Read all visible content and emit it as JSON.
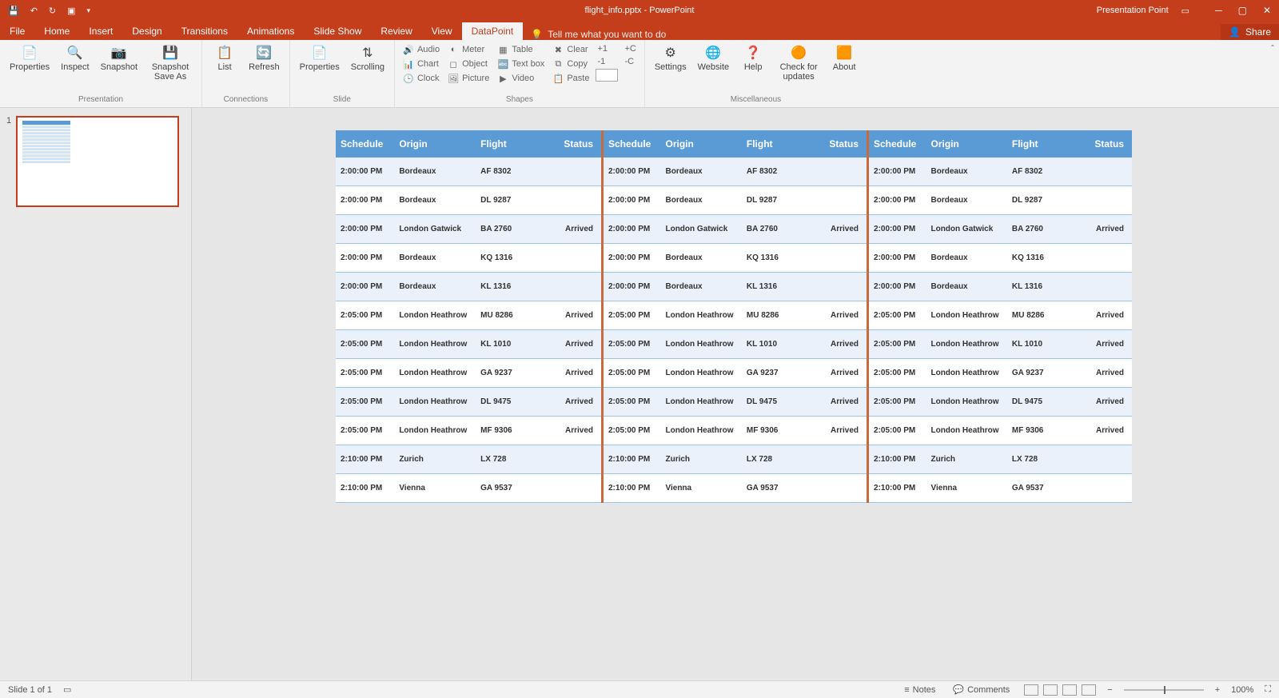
{
  "titlebar": {
    "doc_title": "flight_info.pptx - PowerPoint",
    "account": "Presentation Point"
  },
  "menu": {
    "tabs": [
      "File",
      "Home",
      "Insert",
      "Design",
      "Transitions",
      "Animations",
      "Slide Show",
      "Review",
      "View",
      "DataPoint"
    ],
    "active": "DataPoint",
    "tell_me": "Tell me what you want to do",
    "share": "Share"
  },
  "ribbon": {
    "groups": {
      "presentation": {
        "label": "Presentation",
        "buttons": [
          "Properties",
          "Inspect",
          "Snapshot",
          "Snapshot Save As"
        ]
      },
      "connections": {
        "label": "Connections",
        "buttons": [
          "List",
          "Refresh"
        ]
      },
      "slide": {
        "label": "Slide",
        "buttons": [
          "Properties",
          "Scrolling"
        ]
      },
      "shapes": {
        "label": "Shapes",
        "col1": [
          "Audio",
          "Chart",
          "Clock"
        ],
        "col2": [
          "Meter",
          "Object",
          "Picture"
        ],
        "col3": [
          "Table",
          "Text box",
          "Video"
        ],
        "col4": [
          "Clear",
          "Copy",
          "Paste"
        ],
        "col5": [
          "+1",
          "-1"
        ],
        "col6": [
          "+C",
          "-C"
        ]
      },
      "misc": {
        "label": "Miscellaneous",
        "buttons": [
          "Settings",
          "Website",
          "Help",
          "Check for updates",
          "About"
        ]
      }
    }
  },
  "thumb": {
    "number": "1"
  },
  "table": {
    "headers": [
      "Schedule",
      "Origin",
      "Flight",
      "Status"
    ],
    "rows": [
      {
        "schedule": "2:00:00 PM",
        "origin": "Bordeaux",
        "flight": "AF 8302",
        "status": ""
      },
      {
        "schedule": "2:00:00 PM",
        "origin": "Bordeaux",
        "flight": "DL 9287",
        "status": ""
      },
      {
        "schedule": "2:00:00 PM",
        "origin": "London Gatwick",
        "flight": "BA 2760",
        "status": "Arrived"
      },
      {
        "schedule": "2:00:00 PM",
        "origin": "Bordeaux",
        "flight": "KQ 1316",
        "status": ""
      },
      {
        "schedule": "2:00:00 PM",
        "origin": "Bordeaux",
        "flight": "KL 1316",
        "status": ""
      },
      {
        "schedule": "2:05:00 PM",
        "origin": "London Heathrow",
        "flight": "MU 8286",
        "status": "Arrived"
      },
      {
        "schedule": "2:05:00 PM",
        "origin": "London Heathrow",
        "flight": "KL 1010",
        "status": "Arrived"
      },
      {
        "schedule": "2:05:00 PM",
        "origin": "London Heathrow",
        "flight": "GA 9237",
        "status": "Arrived"
      },
      {
        "schedule": "2:05:00 PM",
        "origin": "London Heathrow",
        "flight": "DL 9475",
        "status": "Arrived"
      },
      {
        "schedule": "2:05:00 PM",
        "origin": "London Heathrow",
        "flight": "MF 9306",
        "status": "Arrived"
      },
      {
        "schedule": "2:10:00 PM",
        "origin": "Zurich",
        "flight": "LX 728",
        "status": ""
      },
      {
        "schedule": "2:10:00 PM",
        "origin": "Vienna",
        "flight": "GA 9537",
        "status": ""
      }
    ]
  },
  "statusbar": {
    "slide_info": "Slide 1 of 1",
    "notes": "Notes",
    "comments": "Comments",
    "zoom": "100%"
  }
}
